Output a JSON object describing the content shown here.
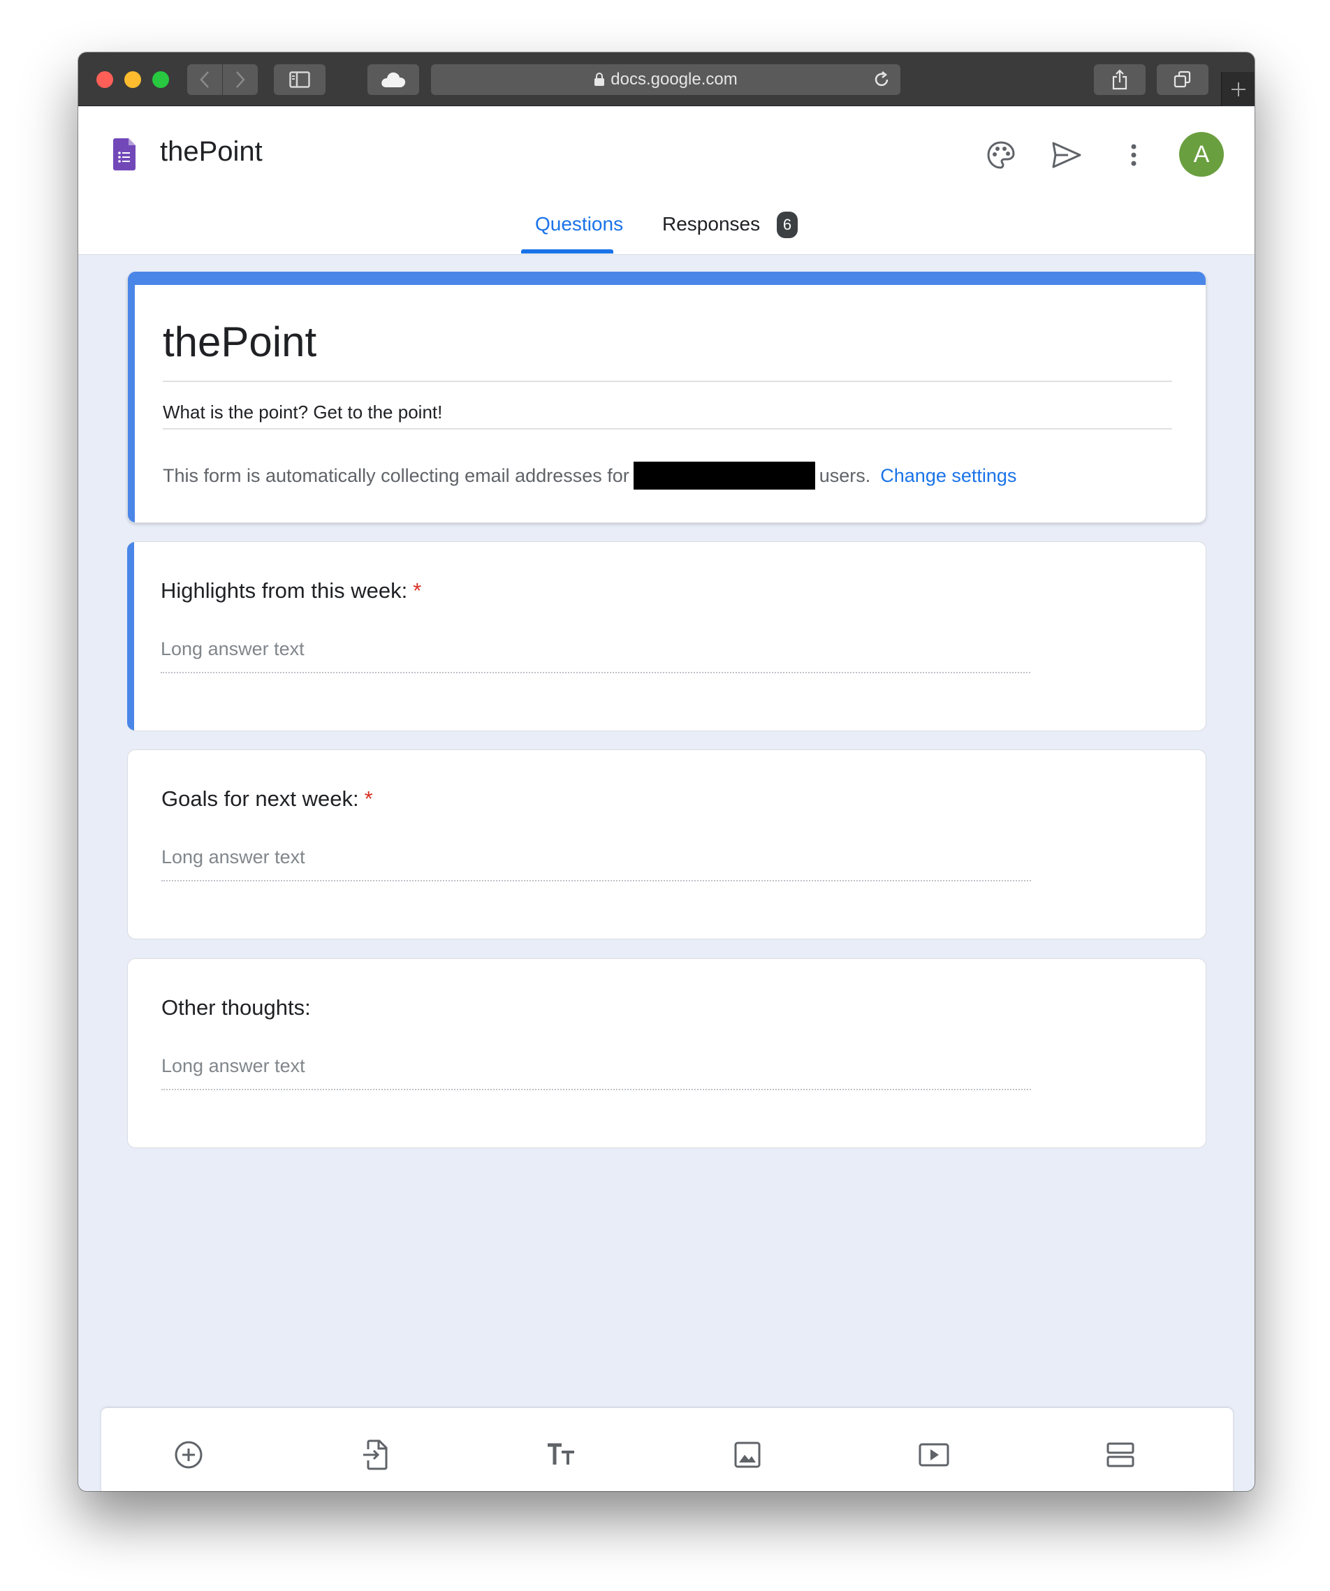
{
  "browser": {
    "url": "docs.google.com"
  },
  "header": {
    "doc_title": "thePoint",
    "avatar_letter": "A",
    "tabs": [
      {
        "label": "Questions",
        "active": true
      },
      {
        "label": "Responses",
        "active": false,
        "badge": "6"
      }
    ]
  },
  "form": {
    "title": "thePoint",
    "description": "What is the point?  Get to the point!",
    "email_note_prefix": "This form is automatically collecting email addresses for",
    "email_note_suffix": "users.",
    "change_settings": "Change settings"
  },
  "questions": [
    {
      "title": "Highlights from this week:",
      "required_mark": "*",
      "answer_placeholder": "Long answer text"
    },
    {
      "title": "Goals for next week:",
      "required_mark": "*",
      "answer_placeholder": "Long answer text"
    },
    {
      "title": "Other thoughts:",
      "answer_placeholder": "Long answer text"
    }
  ],
  "bottom_toolbar": {
    "icons": [
      "add-question-icon",
      "import-questions-icon",
      "add-title-icon",
      "add-image-icon",
      "add-video-icon",
      "add-section-icon"
    ]
  },
  "colors": {
    "accent": "#1a73e8",
    "theme": "#4a86e8",
    "required": "#d93025",
    "avatar": "#6a9f3f",
    "forms_logo": "#7248b9"
  }
}
